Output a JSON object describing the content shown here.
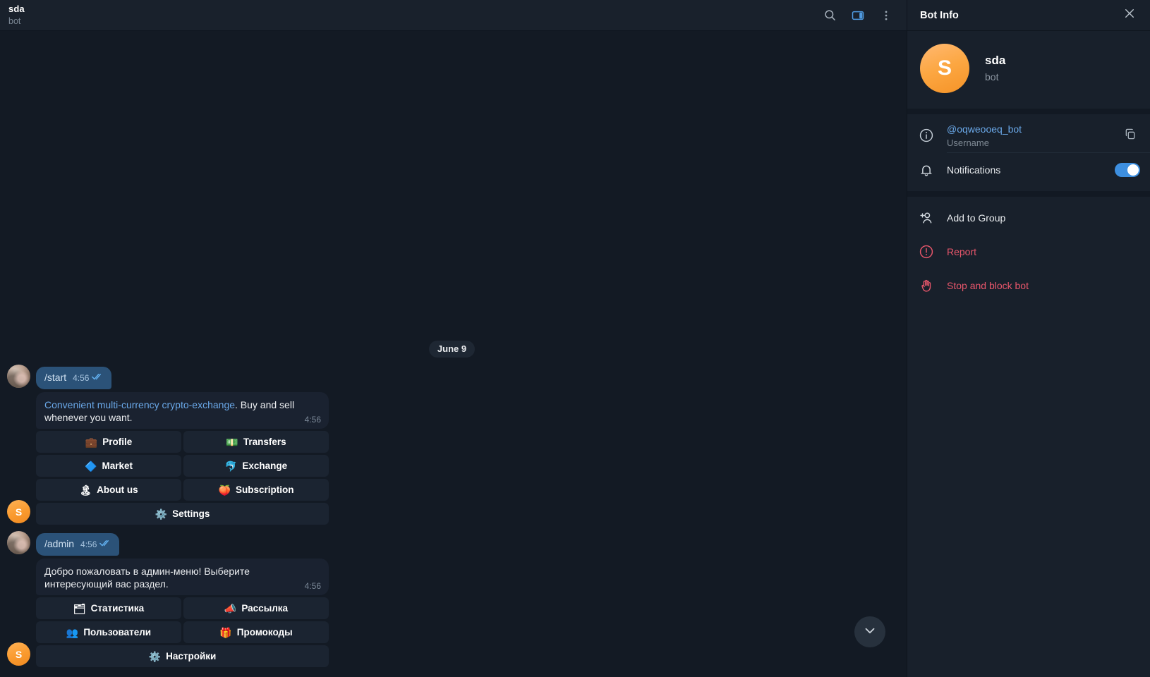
{
  "chat_header": {
    "title": "sda",
    "subtitle": "bot",
    "actions": [
      {
        "name": "search-icon",
        "label": "Search"
      },
      {
        "name": "toggle-info-panel-icon",
        "label": "Toggle info panel"
      },
      {
        "name": "more-options-icon",
        "label": "More"
      }
    ]
  },
  "conversation": {
    "date_separator": "June 9",
    "messages": [
      {
        "direction": "out",
        "text": "/start",
        "time": "4:56",
        "status": "read",
        "ticks": "✓✓"
      },
      {
        "direction": "in",
        "text_link": "Convenient multi-currency crypto-exchange",
        "text_rest": ". Buy and sell whenever you want.",
        "time": "4:56",
        "keyboard": [
          [
            {
              "emoji": "💼",
              "label": "Profile"
            },
            {
              "emoji": "💵",
              "label": "Transfers"
            }
          ],
          [
            {
              "emoji": "🔷",
              "label": "Market"
            },
            {
              "emoji": "🐬",
              "label": "Exchange"
            }
          ],
          [
            {
              "emoji": "🏝",
              "label": "About us"
            },
            {
              "emoji": "🍑",
              "label": "Subscription"
            }
          ],
          [
            {
              "emoji": "⚙️",
              "label": "Settings"
            }
          ]
        ]
      },
      {
        "direction": "out",
        "text": "/admin",
        "time": "4:56",
        "status": "read",
        "ticks": "✓✓"
      },
      {
        "direction": "in",
        "text_link": "",
        "text_rest": "Добро пожаловать в админ-меню! Выберите интересующий вас раздел.",
        "time": "4:56",
        "keyboard": [
          [
            {
              "emoji": "🗂",
              "label": "Статистика"
            },
            {
              "emoji": "📣",
              "label": "Рассылка"
            }
          ],
          [
            {
              "emoji": "👥",
              "label": "Пользователи"
            },
            {
              "emoji": "🎁",
              "label": "Промокоды"
            }
          ],
          [
            {
              "emoji": "⚙️",
              "label": "Настройки"
            }
          ]
        ]
      }
    ],
    "scroll_down_button": "scroll-to-bottom"
  },
  "panel": {
    "title": "Bot Info",
    "close_label": "×",
    "profile": {
      "avatar_letter": "S",
      "name": "sda",
      "subtitle": "bot"
    },
    "username_row": {
      "value": "@oqweooeq_bot",
      "caption": "Username",
      "copy_label": "Copy"
    },
    "notifications_row": {
      "label": "Notifications",
      "enabled": true
    },
    "actions": [
      {
        "name": "add-to-group",
        "label": "Add to Group",
        "danger": false
      },
      {
        "name": "report",
        "label": "Report",
        "danger": true
      },
      {
        "name": "stop-and-block-bot",
        "label": "Stop and block bot",
        "danger": true
      }
    ]
  },
  "colors": {
    "accent_blue": "#3390ec",
    "outgoing_bubble": "#2b5278",
    "incoming_bubble": "#1a2230",
    "danger": "#e8566b",
    "avatar_orange": "#fca742",
    "chat_bg": "#131a24",
    "panel_bg": "#18202b"
  }
}
